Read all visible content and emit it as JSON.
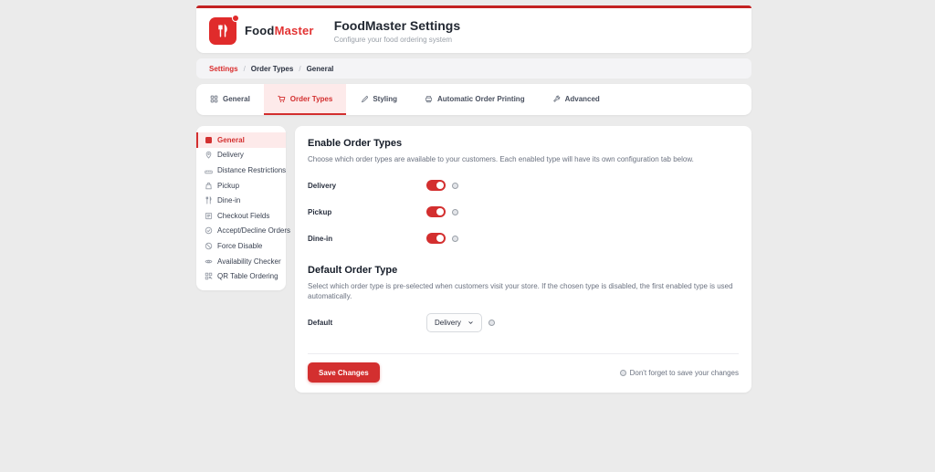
{
  "theme": {
    "accent": "#d32f2f",
    "accent_light": "#fdeaea",
    "top_line": "#c32222",
    "page_bg": "#ebebeb",
    "text_dark": "#1f2733",
    "text_gray": "#6b7280"
  },
  "header": {
    "logo_icon": "utensils-icon",
    "brand_bold": "Food",
    "brand_accent": "Master",
    "title": "FoodMaster Settings",
    "subtitle": "Configure your food ordering system"
  },
  "breadcrumb": {
    "separator": "/",
    "items": [
      {
        "label": "Settings",
        "active": true
      },
      {
        "label": "Order Types",
        "active": false
      },
      {
        "label": "General",
        "active": false
      }
    ]
  },
  "tabs": [
    {
      "label": "General",
      "icon": "grid-icon",
      "active": false
    },
    {
      "label": "Order Types",
      "icon": "cart-icon",
      "active": true
    },
    {
      "label": "Styling",
      "icon": "brush-icon",
      "active": false
    },
    {
      "label": "Automatic Order Printing",
      "icon": "printer-icon",
      "active": false
    },
    {
      "label": "Advanced",
      "icon": "wrench-icon",
      "active": false
    }
  ],
  "sidebar": {
    "items": [
      {
        "label": "General",
        "icon": "grid-icon",
        "active": true
      },
      {
        "label": "Delivery",
        "icon": "map-pin-icon",
        "active": false
      },
      {
        "label": "Distance Restrictions",
        "icon": "ruler-icon",
        "active": false
      },
      {
        "label": "Pickup",
        "icon": "shopping-bag-icon",
        "active": false
      },
      {
        "label": "Dine-in",
        "icon": "utensils-icon",
        "active": false
      },
      {
        "label": "Checkout Fields",
        "icon": "form-icon",
        "active": false
      },
      {
        "label": "Accept/Decline Orders",
        "icon": "check-circle-icon",
        "active": false
      },
      {
        "label": "Force Disable",
        "icon": "ban-icon",
        "active": false
      },
      {
        "label": "Availability Checker",
        "icon": "eye-icon",
        "active": false
      },
      {
        "label": "QR Table Ordering",
        "icon": "qr-icon",
        "active": false
      }
    ]
  },
  "main": {
    "enable_section": {
      "title": "Enable Order Types",
      "description": "Choose which order types are available to your customers. Each enabled type will have its own configuration tab below.",
      "toggles": [
        {
          "label": "Delivery",
          "on": true
        },
        {
          "label": "Pickup",
          "on": true
        },
        {
          "label": "Dine-in",
          "on": true
        }
      ]
    },
    "default_section": {
      "title": "Default Order Type",
      "description": "Select which order type is pre-selected when customers visit your store. If the chosen type is disabled, the first enabled type is used automatically.",
      "field_label": "Default",
      "selected_option": "Delivery"
    },
    "footer": {
      "save_label": "Save Changes",
      "reminder": "Don't forget to save your changes"
    }
  }
}
